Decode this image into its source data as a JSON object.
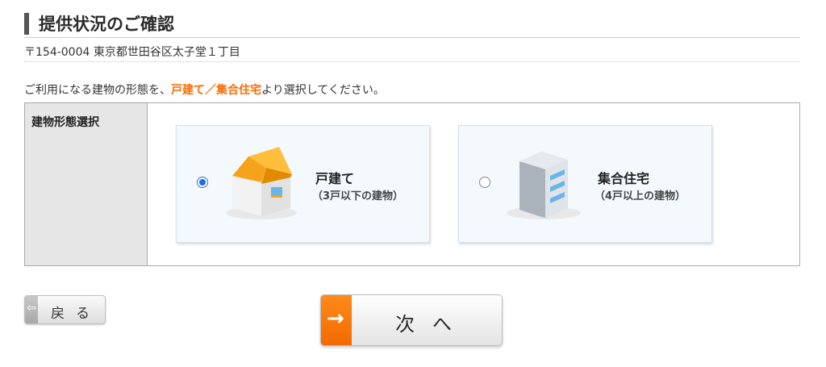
{
  "header": {
    "title": "提供状況のご確認"
  },
  "address": {
    "text": "〒154-0004 東京都世田谷区太子堂１丁目"
  },
  "instruction": {
    "before": "ご利用になる建物の形態を、",
    "highlight": "戸建て／集合住宅",
    "after": "より選択してください。"
  },
  "selection": {
    "label": "建物形態選択",
    "options": [
      {
        "title": "戸建て",
        "subtitle": "（3戸以下の建物）",
        "selected": true,
        "icon": "house-icon"
      },
      {
        "title": "集合住宅",
        "subtitle": "（4戸以上の建物）",
        "selected": false,
        "icon": "apartment-building-icon"
      }
    ]
  },
  "buttons": {
    "back_label": "戻る",
    "back_icon": "chevron-left-icon",
    "next_label": "次へ",
    "next_icon": "arrow-right-icon"
  },
  "colors": {
    "accent_orange": "#ff6a00",
    "radio_blue": "#1a6ee8",
    "label_bg": "#e6e6e6"
  }
}
